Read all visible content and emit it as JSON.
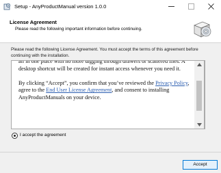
{
  "window": {
    "title": "Setup - AnyProductManual version 1.0.0",
    "icons": [
      "app-icon",
      "minimize-icon",
      "maximize-icon",
      "close-icon"
    ]
  },
  "header": {
    "title": "License Agreement",
    "subtitle": "Please read the following important information before continuing.",
    "icon": "software-box-disc-icon"
  },
  "intro": "Please read the following License Agreement. You must accept the terms of this agreement before continuing with the installation.",
  "agreement": {
    "paragraph1": "all in one place with no more digging through drawers or scattered files.  A desktop shortcut will be created for instant access whenever you need it.",
    "p2_before": "By clicking “Accept”, you confirm that you’ve reviewed the ",
    "privacy_link": "Privacy Policy",
    "p2_middle": ", agree to the ",
    "eula_link": "End User License Agreement",
    "p2_after": ", and consent to installing AnyProductManuals on your device."
  },
  "radio": {
    "label": "I accept the agreement",
    "checked": true
  },
  "buttons": {
    "accept": "Accept"
  },
  "colors": {
    "link": "#2a5db0",
    "button_border": "#0078d7",
    "button_bg": "#e5f1fb"
  }
}
